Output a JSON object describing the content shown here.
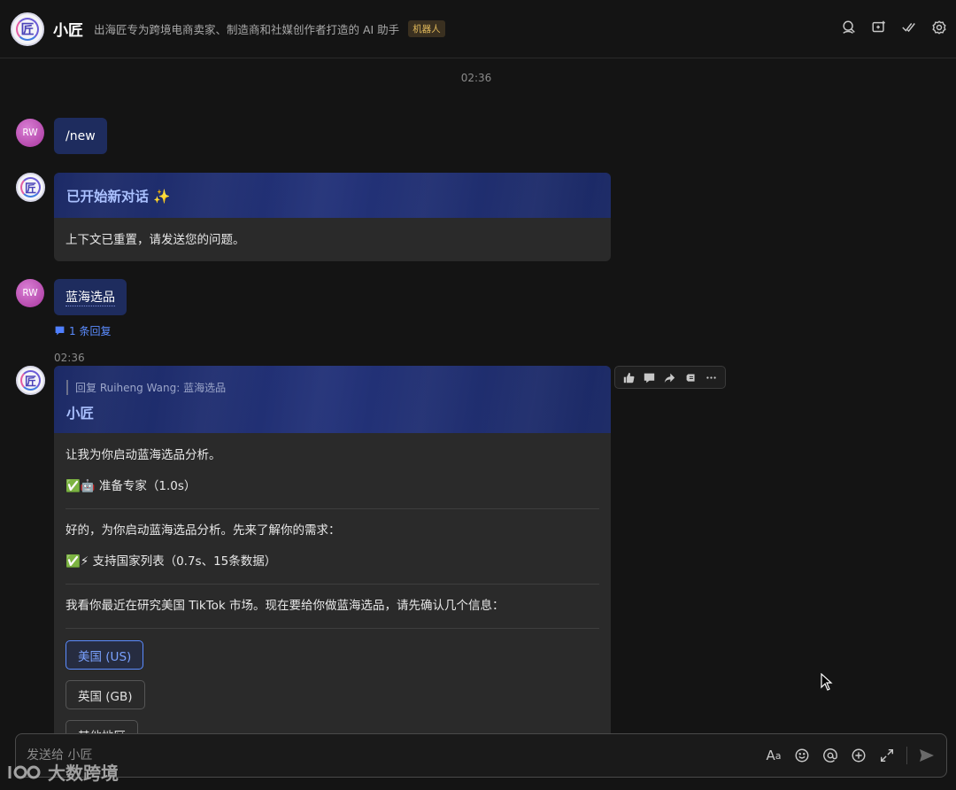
{
  "header": {
    "title": "小匠",
    "description": "出海匠专为跨境电商卖家、制造商和社媒创作者打造的 AI 助手",
    "badge": "机器人",
    "bot_glyph": "匠"
  },
  "timestamp_top": "02:36",
  "messages": {
    "m1": {
      "avatar": "RW",
      "text": "/new"
    },
    "m2": {
      "title": "已开始新对话 ✨",
      "body": "上下文已重置，请发送您的问题。"
    },
    "m3": {
      "avatar": "RW",
      "text": "蓝海选品",
      "reply_count": "1 条回复"
    },
    "m4": {
      "time": "02:36",
      "quote": "回复 Ruiheng Wang: 蓝海选品",
      "title": "小匠",
      "line1": "让我为你启动蓝海选品分析。",
      "step1": "✅🤖 准备专家（1.0s）",
      "line2": "好的，为你启动蓝海选品分析。先来了解你的需求：",
      "step2": "✅⚡ 支持国家列表（0.7s、15条数据）",
      "line3": "我看你最近在研究美国 TikTok 市场。现在要给你做蓝海选品，请先确认几个信息：",
      "options": [
        "美国 (US)",
        "英国 (GB)",
        "其他地区"
      ]
    }
  },
  "composer": {
    "placeholder": "发送给 小匠"
  },
  "watermark": "大数跨境",
  "colors": {
    "background": "#141414",
    "user_bubble": "#1e2c5e",
    "card_header": "#1f2d6d",
    "accent": "#5b8cff"
  },
  "icons": {
    "header": [
      "search-icon",
      "new-chat-icon",
      "check-icon",
      "settings-icon"
    ],
    "actions": [
      "thumbs-up-icon",
      "comment-icon",
      "forward-icon",
      "pin-icon",
      "more-icon"
    ],
    "composer": [
      "font-icon",
      "emoji-icon",
      "mention-icon",
      "add-icon",
      "expand-icon",
      "send-icon"
    ]
  }
}
